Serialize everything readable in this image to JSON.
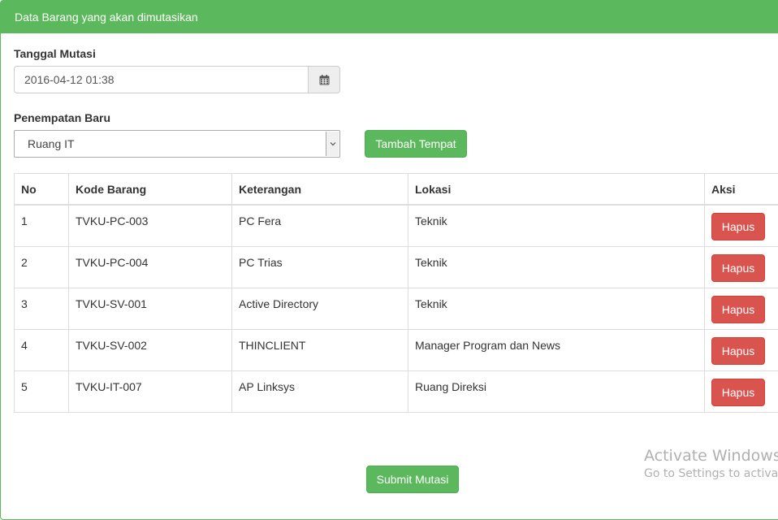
{
  "panel": {
    "heading": "Data Barang yang akan dimutasikan"
  },
  "form": {
    "tanggal_label": "Tanggal Mutasi",
    "tanggal_value": "2016-04-12 01:38",
    "penempatan_label": "Penempatan Baru",
    "penempatan_value": "Ruang IT",
    "tambah_button": "Tambah Tempat"
  },
  "table": {
    "headers": [
      "No",
      "Kode Barang",
      "Keterangan",
      "Lokasi",
      "Aksi"
    ],
    "rows": [
      {
        "no": "1",
        "kode": "TVKU-PC-003",
        "keterangan": "PC Fera",
        "lokasi": "Teknik",
        "aksi": "Hapus"
      },
      {
        "no": "2",
        "kode": "TVKU-PC-004",
        "keterangan": "PC Trias",
        "lokasi": "Teknik",
        "aksi": "Hapus"
      },
      {
        "no": "3",
        "kode": "TVKU-SV-001",
        "keterangan": "Active Directory",
        "lokasi": "Teknik",
        "aksi": "Hapus"
      },
      {
        "no": "4",
        "kode": "TVKU-SV-002",
        "keterangan": "THINCLIENT",
        "lokasi": "Manager Program dan News",
        "aksi": "Hapus"
      },
      {
        "no": "5",
        "kode": "TVKU-IT-007",
        "keterangan": "AP Linksys",
        "lokasi": "Ruang Direksi",
        "aksi": "Hapus"
      }
    ]
  },
  "submit_button": "Submit Mutasi",
  "watermark": {
    "line1": "Activate Windows",
    "line2": "Go to Settings to activate"
  },
  "colors": {
    "success": "#5cb85c",
    "danger": "#d9534f",
    "border": "#dddddd"
  },
  "icons": {
    "date_addon": "calendar-icon",
    "select_arrow": "chevron-down-icon"
  }
}
